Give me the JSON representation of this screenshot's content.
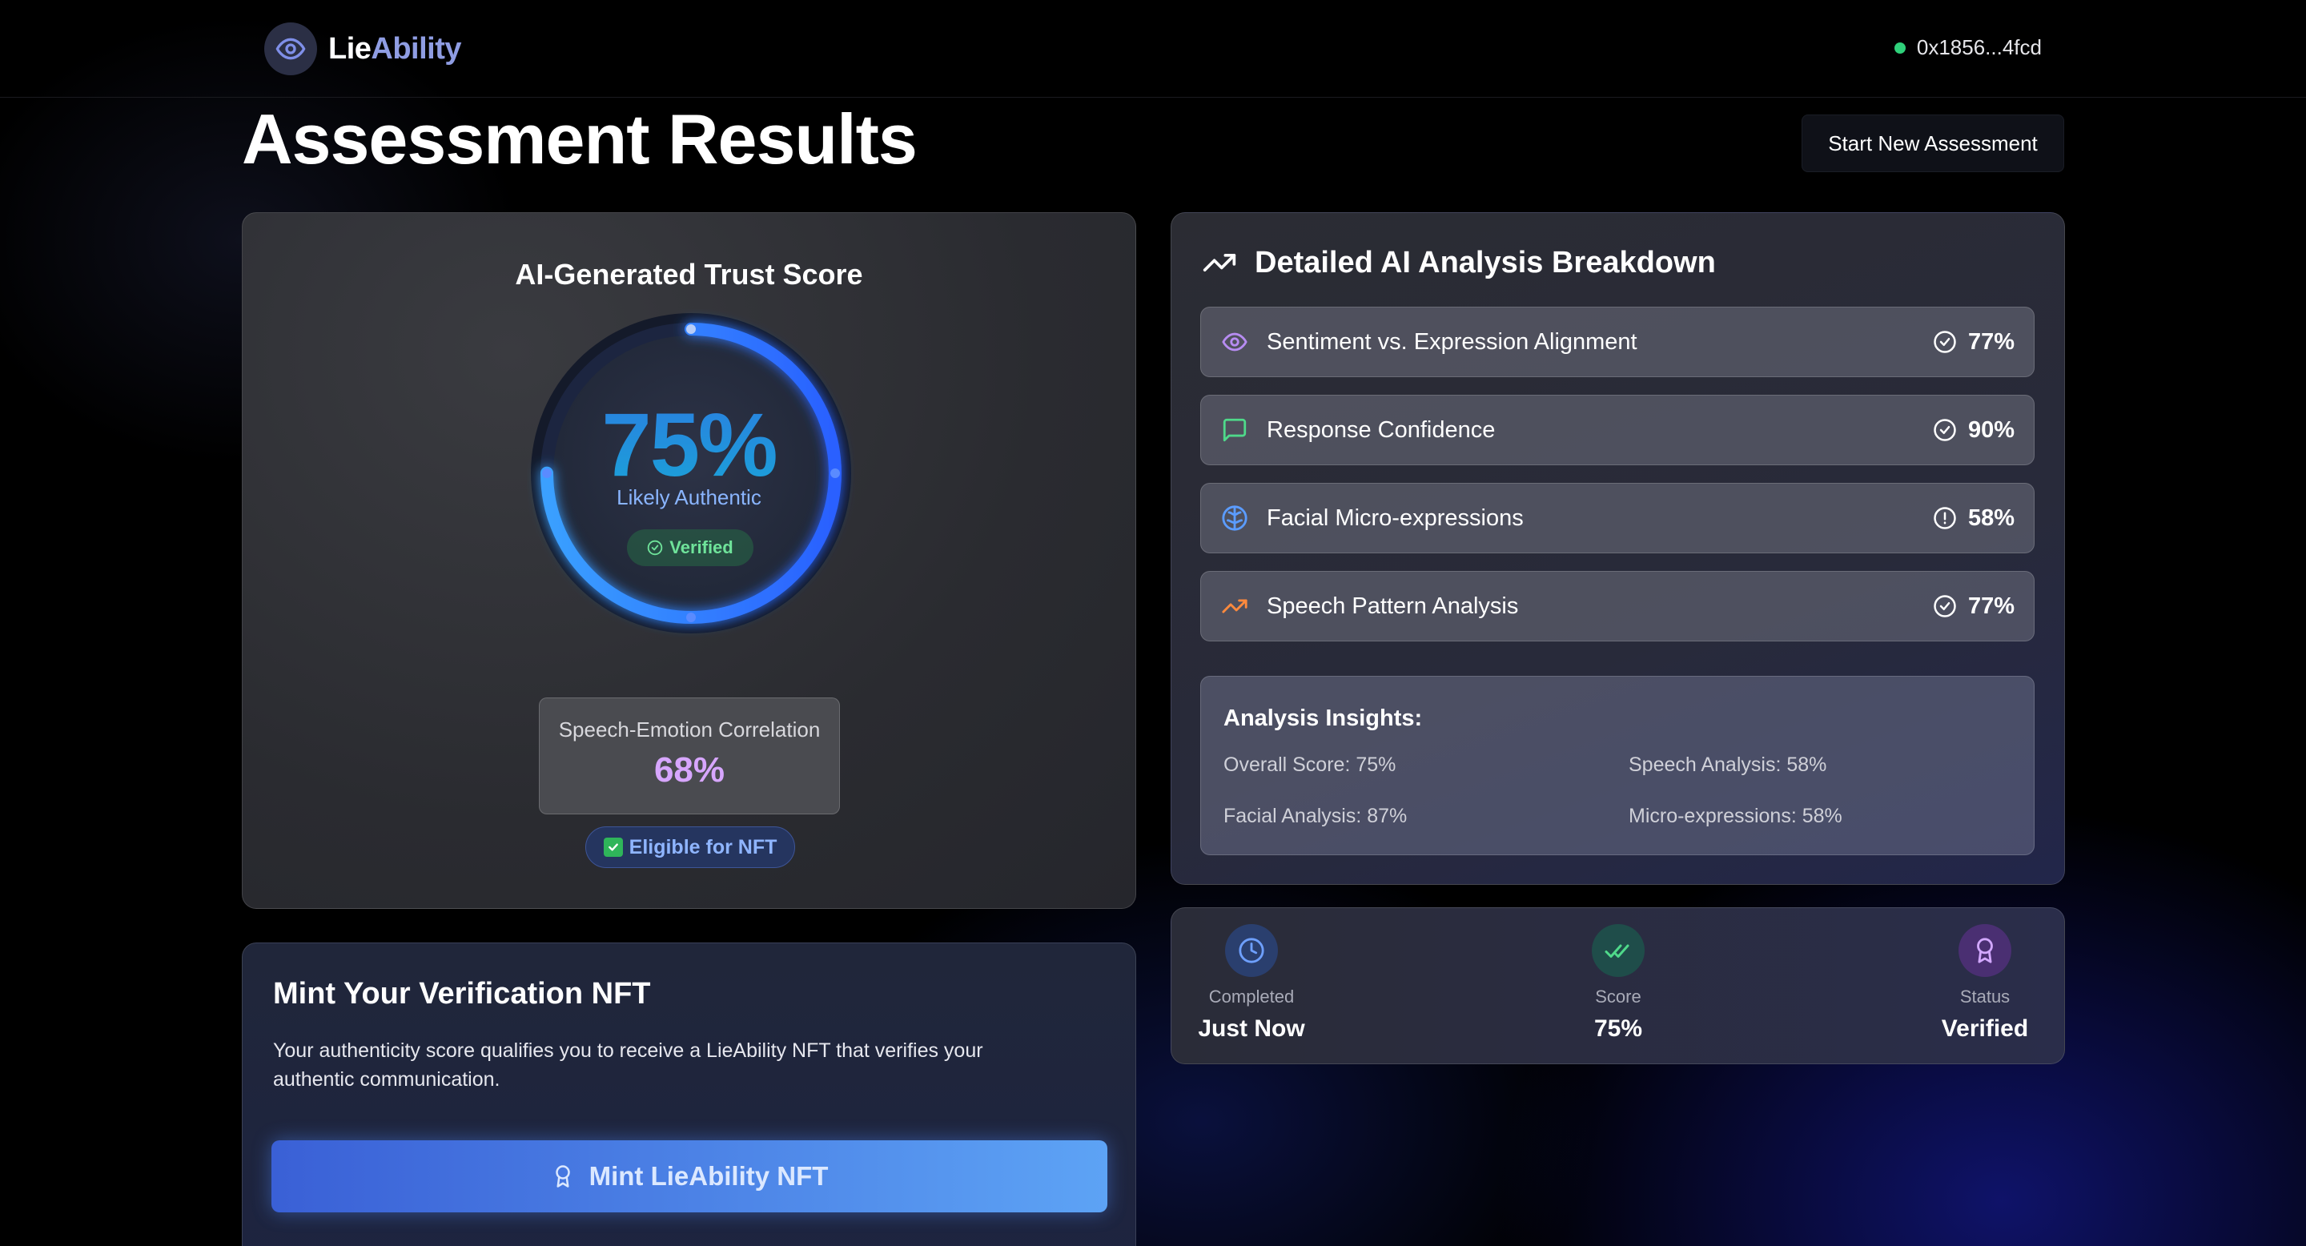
{
  "header": {
    "logo_part1": "Lie",
    "logo_part2": "Ability",
    "wallet_address": "0x1856...4fcd"
  },
  "page": {
    "title": "Assessment Results",
    "new_assessment_label": "Start New Assessment"
  },
  "trust_score": {
    "title": "AI-Generated Trust Score",
    "value": "75%",
    "value_fraction": 0.75,
    "label": "Likely Authentic",
    "verified_label": "Verified",
    "correlation_label": "Speech-Emotion Correlation",
    "correlation_value": "68%",
    "nft_eligibility": "Eligible for NFT"
  },
  "analysis": {
    "title": "Detailed AI Analysis Breakdown",
    "metrics": [
      {
        "label": "Sentiment vs. Expression Alignment",
        "value": "77%",
        "icon": "eye-icon",
        "status": "check"
      },
      {
        "label": "Response Confidence",
        "value": "90%",
        "icon": "message-icon",
        "status": "check"
      },
      {
        "label": "Facial Micro-expressions",
        "value": "58%",
        "icon": "brain-icon",
        "status": "alert"
      },
      {
        "label": "Speech Pattern Analysis",
        "value": "77%",
        "icon": "trending-up-icon",
        "status": "check"
      }
    ],
    "insights_title": "Analysis Insights:",
    "insights": [
      "Overall Score: 75%",
      "Speech Analysis: 58%",
      "Facial Analysis: 87%",
      "Micro-expressions: 58%"
    ]
  },
  "stats": [
    {
      "label": "Completed",
      "value": "Just Now",
      "icon": "clock-icon"
    },
    {
      "label": "Score",
      "value": "75%",
      "icon": "double-check-icon"
    },
    {
      "label": "Status",
      "value": "Verified",
      "icon": "award-icon"
    }
  ],
  "mint": {
    "title": "Mint Your Verification NFT",
    "description": "Your authenticity score qualifies you to receive a LieAbility NFT that verifies your authentic communication.",
    "button_label": "Mint LieAbility NFT"
  },
  "colors": {
    "accent_blue": "#2a7fe0",
    "brand_purple": "#8f9de3",
    "success_green": "#2fd07a",
    "correlation_purple": "#d7a6ff"
  }
}
